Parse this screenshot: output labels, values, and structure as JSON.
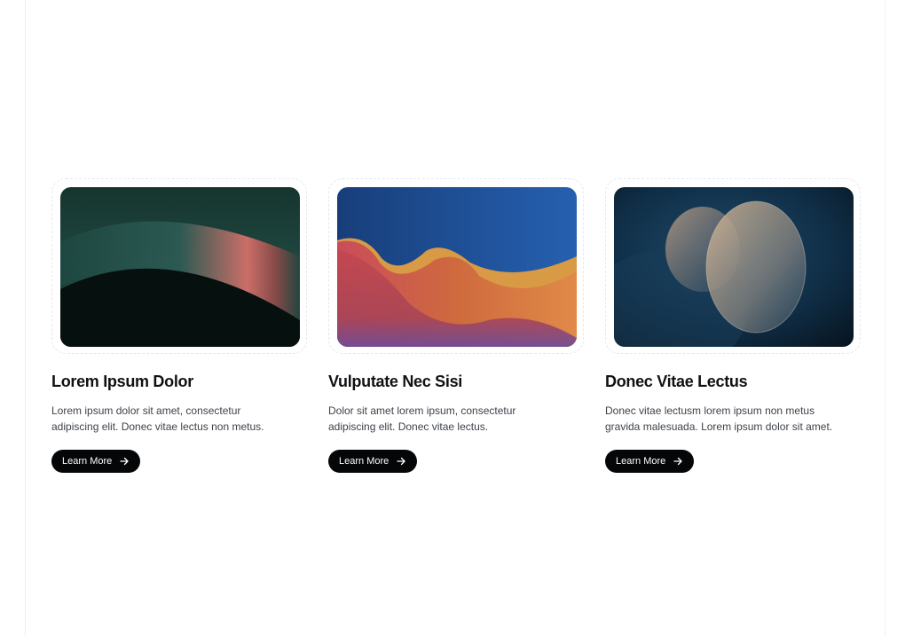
{
  "cards": [
    {
      "title": "Lorem Ipsum Dolor",
      "description": "Lorem ipsum dolor sit amet, consectetur adipiscing elit. Donec vitae lectus non metus.",
      "button_label": "Learn More",
      "button_icon": "arrow-right-icon",
      "image": "abstract-teal-wave-image"
    },
    {
      "title": "Vulputate Nec Sisi",
      "description": "Dolor sit amet lorem ipsum, consectetur adipiscing elit. Donec vitae lectus.",
      "button_label": "Learn More",
      "button_icon": "arrow-right-icon",
      "image": "abstract-orange-wave-image"
    },
    {
      "title": "Donec Vitae Lectus",
      "description": "Donec vitae lectusm lorem ipsum non metus gravida malesuada. Lorem ipsum dolor sit amet.",
      "button_label": "Learn More",
      "button_icon": "arrow-right-icon",
      "image": "abstract-glass-discs-image"
    }
  ],
  "colors": {
    "button_bg": "#050607",
    "title_text": "#0f1115",
    "body_text": "#3d424a"
  }
}
